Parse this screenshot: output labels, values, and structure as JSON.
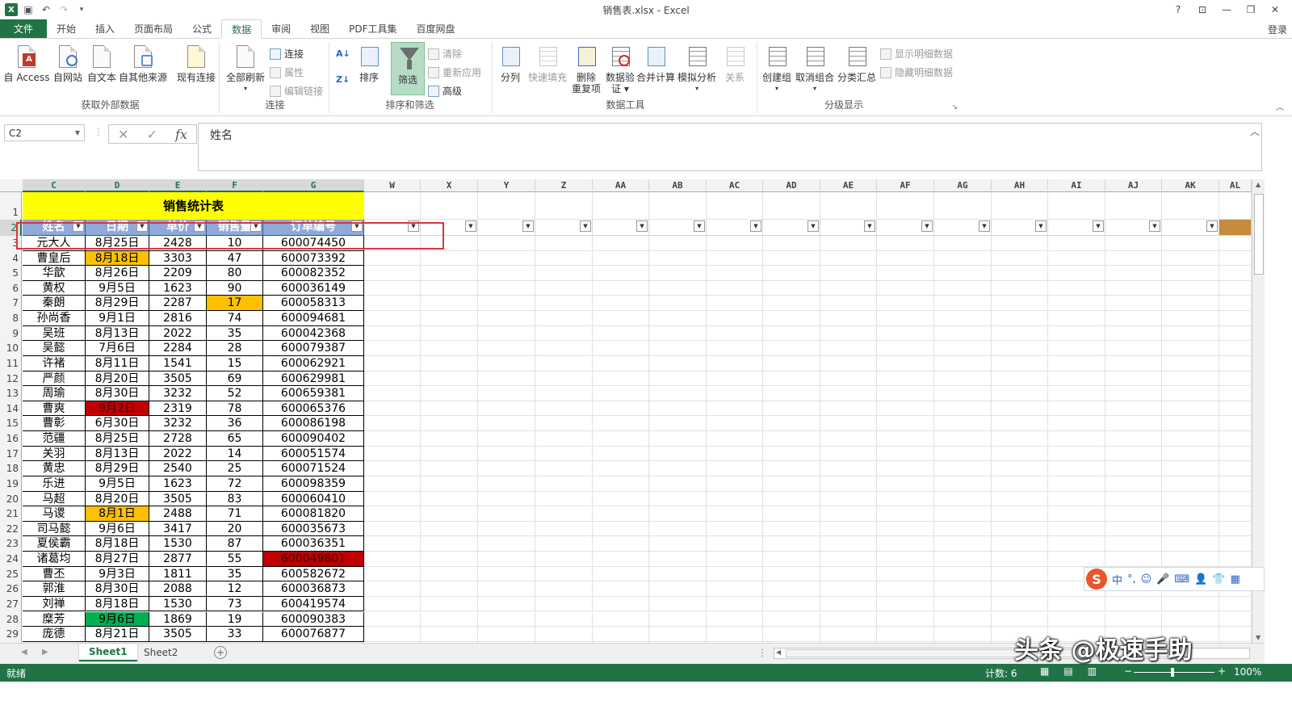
{
  "window": {
    "title": "销售表.xlsx - Excel",
    "help": "?",
    "login": "登录"
  },
  "tabs": [
    "文件",
    "开始",
    "插入",
    "页面布局",
    "公式",
    "数据",
    "审阅",
    "视图",
    "PDF工具集",
    "百度网盘"
  ],
  "ribbon": {
    "groups": {
      "external": "获取外部数据",
      "connections": "连接",
      "sort_filter": "排序和筛选",
      "data_tools": "数据工具",
      "outline": "分级显示"
    },
    "buttons": {
      "from_access": "自 Access",
      "from_web": "自网站",
      "from_text": "自文本",
      "from_other": "自其他来源",
      "existing": "现有连接",
      "refresh_all": "全部刷新",
      "connections": "连接",
      "properties": "属性",
      "edit_links": "编辑链接",
      "sort": "排序",
      "filter": "筛选",
      "clear": "清除",
      "reapply": "重新应用",
      "advanced": "高级",
      "text_to_cols": "分列",
      "flash_fill": "快速填充",
      "remove_dup_1": "删除",
      "remove_dup_2": "重复项",
      "validation_1": "数据验",
      "validation_2": "证 ▾",
      "consolidate": "合并计算",
      "what_if": "模拟分析",
      "relations": "关系",
      "group": "创建组",
      "ungroup": "取消组合",
      "subtotal": "分类汇总",
      "show_detail": "显示明细数据",
      "hide_detail": "隐藏明细数据"
    }
  },
  "formula_bar": {
    "name_box": "C2",
    "content": "姓名",
    "fx": "fx"
  },
  "columns": [
    {
      "id": "C",
      "w": 78
    },
    {
      "id": "D",
      "w": 79
    },
    {
      "id": "E",
      "w": 71
    },
    {
      "id": "F",
      "w": 70
    },
    {
      "id": "G",
      "w": 125
    },
    {
      "id": "W",
      "w": 70
    },
    {
      "id": "X",
      "w": 71
    },
    {
      "id": "Y",
      "w": 71
    },
    {
      "id": "Z",
      "w": 71
    },
    {
      "id": "AA",
      "w": 70
    },
    {
      "id": "AB",
      "w": 71
    },
    {
      "id": "AC",
      "w": 70
    },
    {
      "id": "AD",
      "w": 71
    },
    {
      "id": "AE",
      "w": 70
    },
    {
      "id": "AF",
      "w": 71
    },
    {
      "id": "AG",
      "w": 71
    },
    {
      "id": "AH",
      "w": 70
    },
    {
      "id": "AI",
      "w": 71
    },
    {
      "id": "AJ",
      "w": 70
    },
    {
      "id": "AK",
      "w": 71
    },
    {
      "id": "AL",
      "w": 40
    }
  ],
  "sheet": {
    "title": "销售统计表",
    "headers": [
      "姓名",
      "日期",
      "单价",
      "销售量",
      "订单编号"
    ],
    "rows": [
      [
        "元大人",
        "8月25日",
        "2428",
        "10",
        "600074450"
      ],
      [
        "曹皇后",
        "8月18日",
        "3303",
        "47",
        "600073392"
      ],
      [
        "华歆",
        "8月26日",
        "2209",
        "80",
        "600082352"
      ],
      [
        "黄权",
        "9月5日",
        "1623",
        "90",
        "600036149"
      ],
      [
        "秦朗",
        "8月29日",
        "2287",
        "17",
        "600058313"
      ],
      [
        "孙尚香",
        "9月1日",
        "2816",
        "74",
        "600094681"
      ],
      [
        "吴班",
        "8月13日",
        "2022",
        "35",
        "600042368"
      ],
      [
        "吴懿",
        "7月6日",
        "2284",
        "28",
        "600079387"
      ],
      [
        "许褚",
        "8月11日",
        "1541",
        "15",
        "600062921"
      ],
      [
        "严颜",
        "8月20日",
        "3505",
        "69",
        "600629981"
      ],
      [
        "周瑜",
        "8月30日",
        "3232",
        "52",
        "600659381"
      ],
      [
        "曹爽",
        "9月2日",
        "2319",
        "78",
        "600065376"
      ],
      [
        "曹彰",
        "6月30日",
        "3232",
        "36",
        "600086198"
      ],
      [
        "范疆",
        "8月25日",
        "2728",
        "65",
        "600090402"
      ],
      [
        "关羽",
        "8月13日",
        "2022",
        "14",
        "600051574"
      ],
      [
        "黄忠",
        "8月29日",
        "2540",
        "25",
        "600071524"
      ],
      [
        "乐进",
        "9月5日",
        "1623",
        "72",
        "600098359"
      ],
      [
        "马超",
        "8月20日",
        "3505",
        "83",
        "600060410"
      ],
      [
        "马谡",
        "8月1日",
        "2488",
        "71",
        "600081820"
      ],
      [
        "司马懿",
        "9月6日",
        "3417",
        "20",
        "600035673"
      ],
      [
        "夏侯霸",
        "8月18日",
        "1530",
        "87",
        "600036351"
      ],
      [
        "诸葛均",
        "8月27日",
        "2877",
        "55",
        "600049801"
      ],
      [
        "曹丕",
        "9月3日",
        "1811",
        "35",
        "600582672"
      ],
      [
        "郭淮",
        "8月30日",
        "2088",
        "12",
        "600036873"
      ],
      [
        "刘禅",
        "8月18日",
        "1530",
        "73",
        "600419574"
      ],
      [
        "糜芳",
        "9月6日",
        "1869",
        "19",
        "600090383"
      ],
      [
        "庞德",
        "8月21日",
        "3505",
        "33",
        "600076877"
      ]
    ],
    "highlights": [
      {
        "row": 1,
        "col": 1,
        "color": "#ffc000"
      },
      {
        "row": 4,
        "col": 3,
        "color": "#ffc000"
      },
      {
        "row": 11,
        "col": 1,
        "color": "#c00000"
      },
      {
        "row": 18,
        "col": 1,
        "color": "#ffc000"
      },
      {
        "row": 21,
        "col": 4,
        "color": "#c00000"
      },
      {
        "row": 25,
        "col": 1,
        "color": "#00b050"
      }
    ]
  },
  "sheet_tabs": [
    "Sheet1",
    "Sheet2"
  ],
  "status": {
    "ready": "就绪",
    "count": "计数: 6",
    "zoom": "100%"
  },
  "watermark": "头条 @极速手助",
  "ime": {
    "cn": "中"
  }
}
